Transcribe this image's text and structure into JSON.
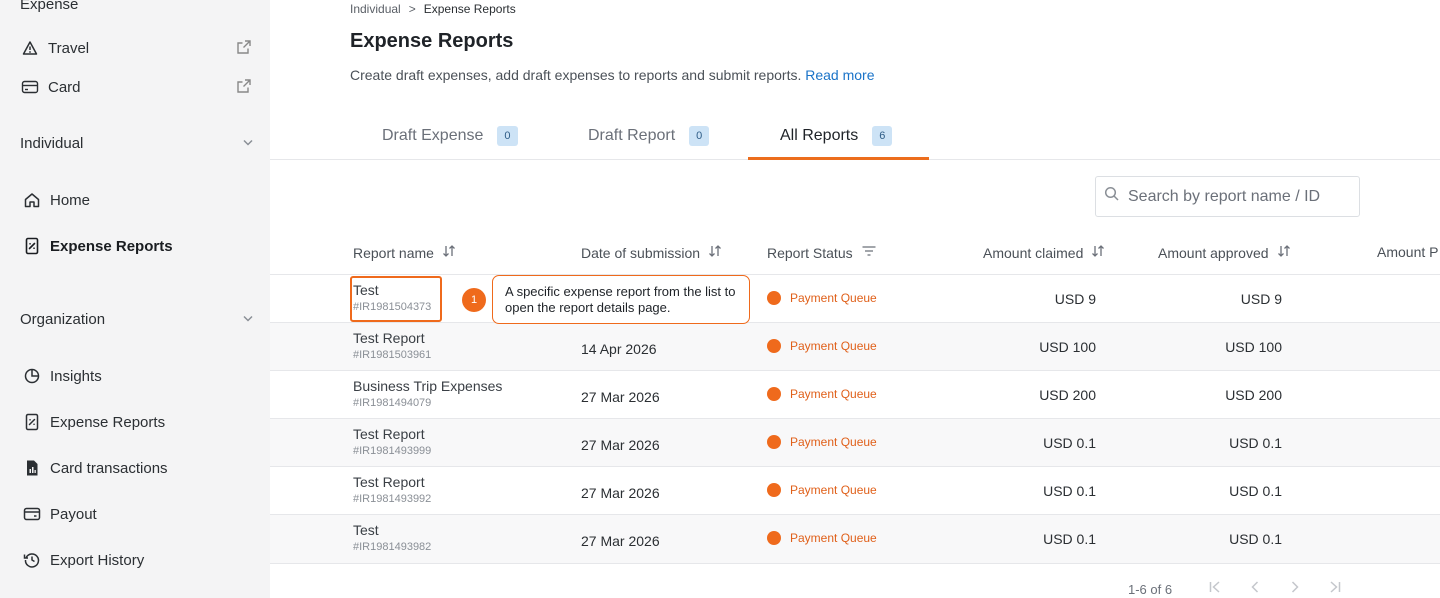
{
  "sidebar": {
    "section_expense": "Expense",
    "travel": "Travel",
    "card": "Card",
    "individual_label": "Individual",
    "individual_items": [
      {
        "label": "Home"
      },
      {
        "label": "Expense Reports"
      }
    ],
    "organization_label": "Organization",
    "organization_items": [
      {
        "label": "Insights"
      },
      {
        "label": "Expense Reports"
      },
      {
        "label": "Card transactions"
      },
      {
        "label": "Payout"
      },
      {
        "label": "Export History"
      }
    ]
  },
  "breadcrumb": {
    "parent": "Individual",
    "separator": ">",
    "current": "Expense Reports"
  },
  "page": {
    "title": "Expense Reports",
    "description": "Create draft expenses, add draft expenses to reports and submit reports.",
    "read_more": "Read more"
  },
  "tabs": [
    {
      "label": "Draft Expense",
      "count": "0"
    },
    {
      "label": "Draft Report",
      "count": "0"
    },
    {
      "label": "All Reports",
      "count": "6"
    }
  ],
  "search": {
    "placeholder": "Search by report name / ID"
  },
  "table": {
    "headers": {
      "name": "Report name",
      "date": "Date of submission",
      "status": "Report Status",
      "claimed": "Amount claimed",
      "approved": "Amount approved",
      "paid": "Amount P"
    },
    "rows": [
      {
        "name": "Test",
        "id": "#IR1981504373",
        "date": "",
        "status": "Payment Queue",
        "claimed": "USD 9",
        "approved": "USD 9"
      },
      {
        "name": "Test Report",
        "id": "#IR1981503961",
        "date": "14 Apr 2026",
        "status": "Payment Queue",
        "claimed": "USD 100",
        "approved": "USD 100"
      },
      {
        "name": "Business Trip Expenses",
        "id": "#IR1981494079",
        "date": "27 Mar 2026",
        "status": "Payment Queue",
        "claimed": "USD 200",
        "approved": "USD 200"
      },
      {
        "name": "Test Report",
        "id": "#IR1981493999",
        "date": "27 Mar 2026",
        "status": "Payment Queue",
        "claimed": "USD 0.1",
        "approved": "USD 0.1"
      },
      {
        "name": "Test Report",
        "id": "#IR1981493992",
        "date": "27 Mar 2026",
        "status": "Payment Queue",
        "claimed": "USD 0.1",
        "approved": "USD 0.1"
      },
      {
        "name": "Test",
        "id": "#IR1981493982",
        "date": "27 Mar 2026",
        "status": "Payment Queue",
        "claimed": "USD 0.1",
        "approved": "USD 0.1"
      }
    ]
  },
  "annotation": {
    "step": "1",
    "text": "A specific expense report from the list to open the report details page."
  },
  "pagination": {
    "summary": "1-6 of 6"
  },
  "colors": {
    "accent": "#ef6a1c",
    "link": "#1a73c8",
    "badge_bg": "#cde3f6"
  }
}
